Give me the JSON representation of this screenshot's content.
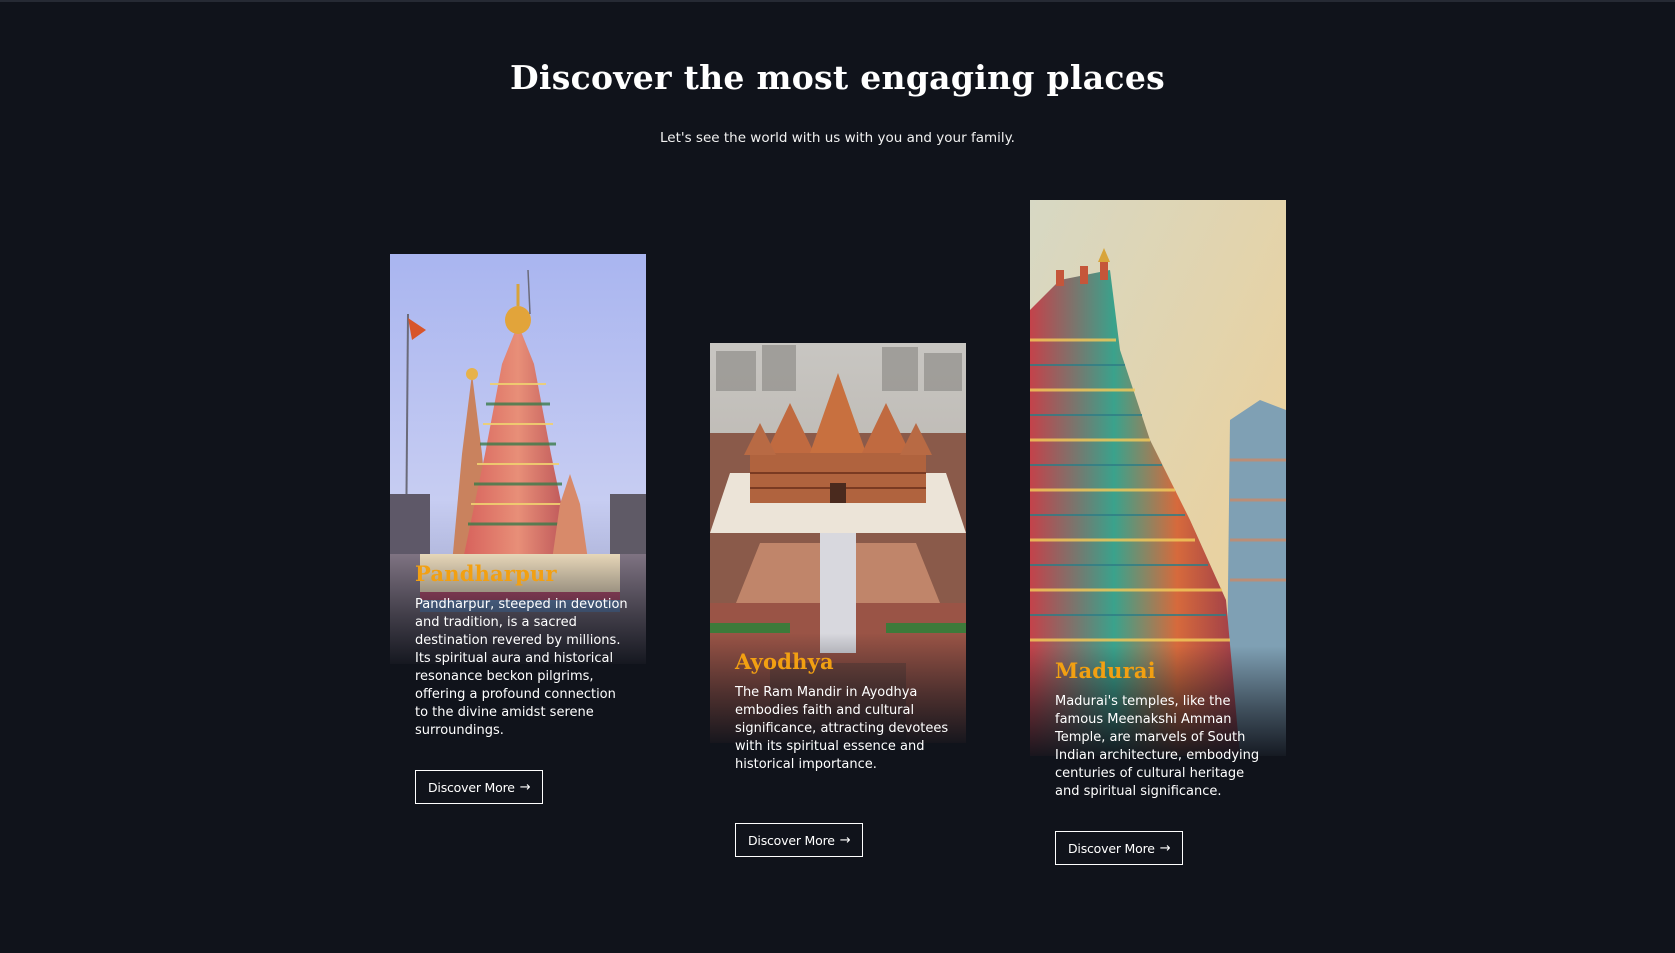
{
  "section": {
    "title": "Discover the most engaging places",
    "subtitle": "Let's see the world with us with you and your family."
  },
  "colors": {
    "background": "#10131b",
    "accent": "#f2a012",
    "text": "#ffffff"
  },
  "cards": [
    {
      "title": "Pandharpur",
      "description": "Pandharpur, steeped in devotion and tradition, is a sacred destination revered by millions. Its spiritual aura and historical resonance beckon pilgrims, offering a profound connection to the divine amidst serene surroundings.",
      "button_label": "Discover More",
      "button_icon": "arrow-right-icon",
      "image": "temple-pandharpur-photo"
    },
    {
      "title": "Ayodhya",
      "description": "The Ram Mandir in Ayodhya embodies faith and cultural significance, attracting devotees with its spiritual essence and historical importance.",
      "button_label": "Discover More",
      "button_icon": "arrow-right-icon",
      "image": "temple-ayodhya-photo"
    },
    {
      "title": "Madurai",
      "description": "Madurai's temples, like the famous Meenakshi Amman Temple, are marvels of South Indian architecture, embodying centuries of cultural heritage and spiritual significance.",
      "button_label": "Discover More",
      "button_icon": "arrow-right-icon",
      "image": "temple-madurai-photo"
    }
  ]
}
